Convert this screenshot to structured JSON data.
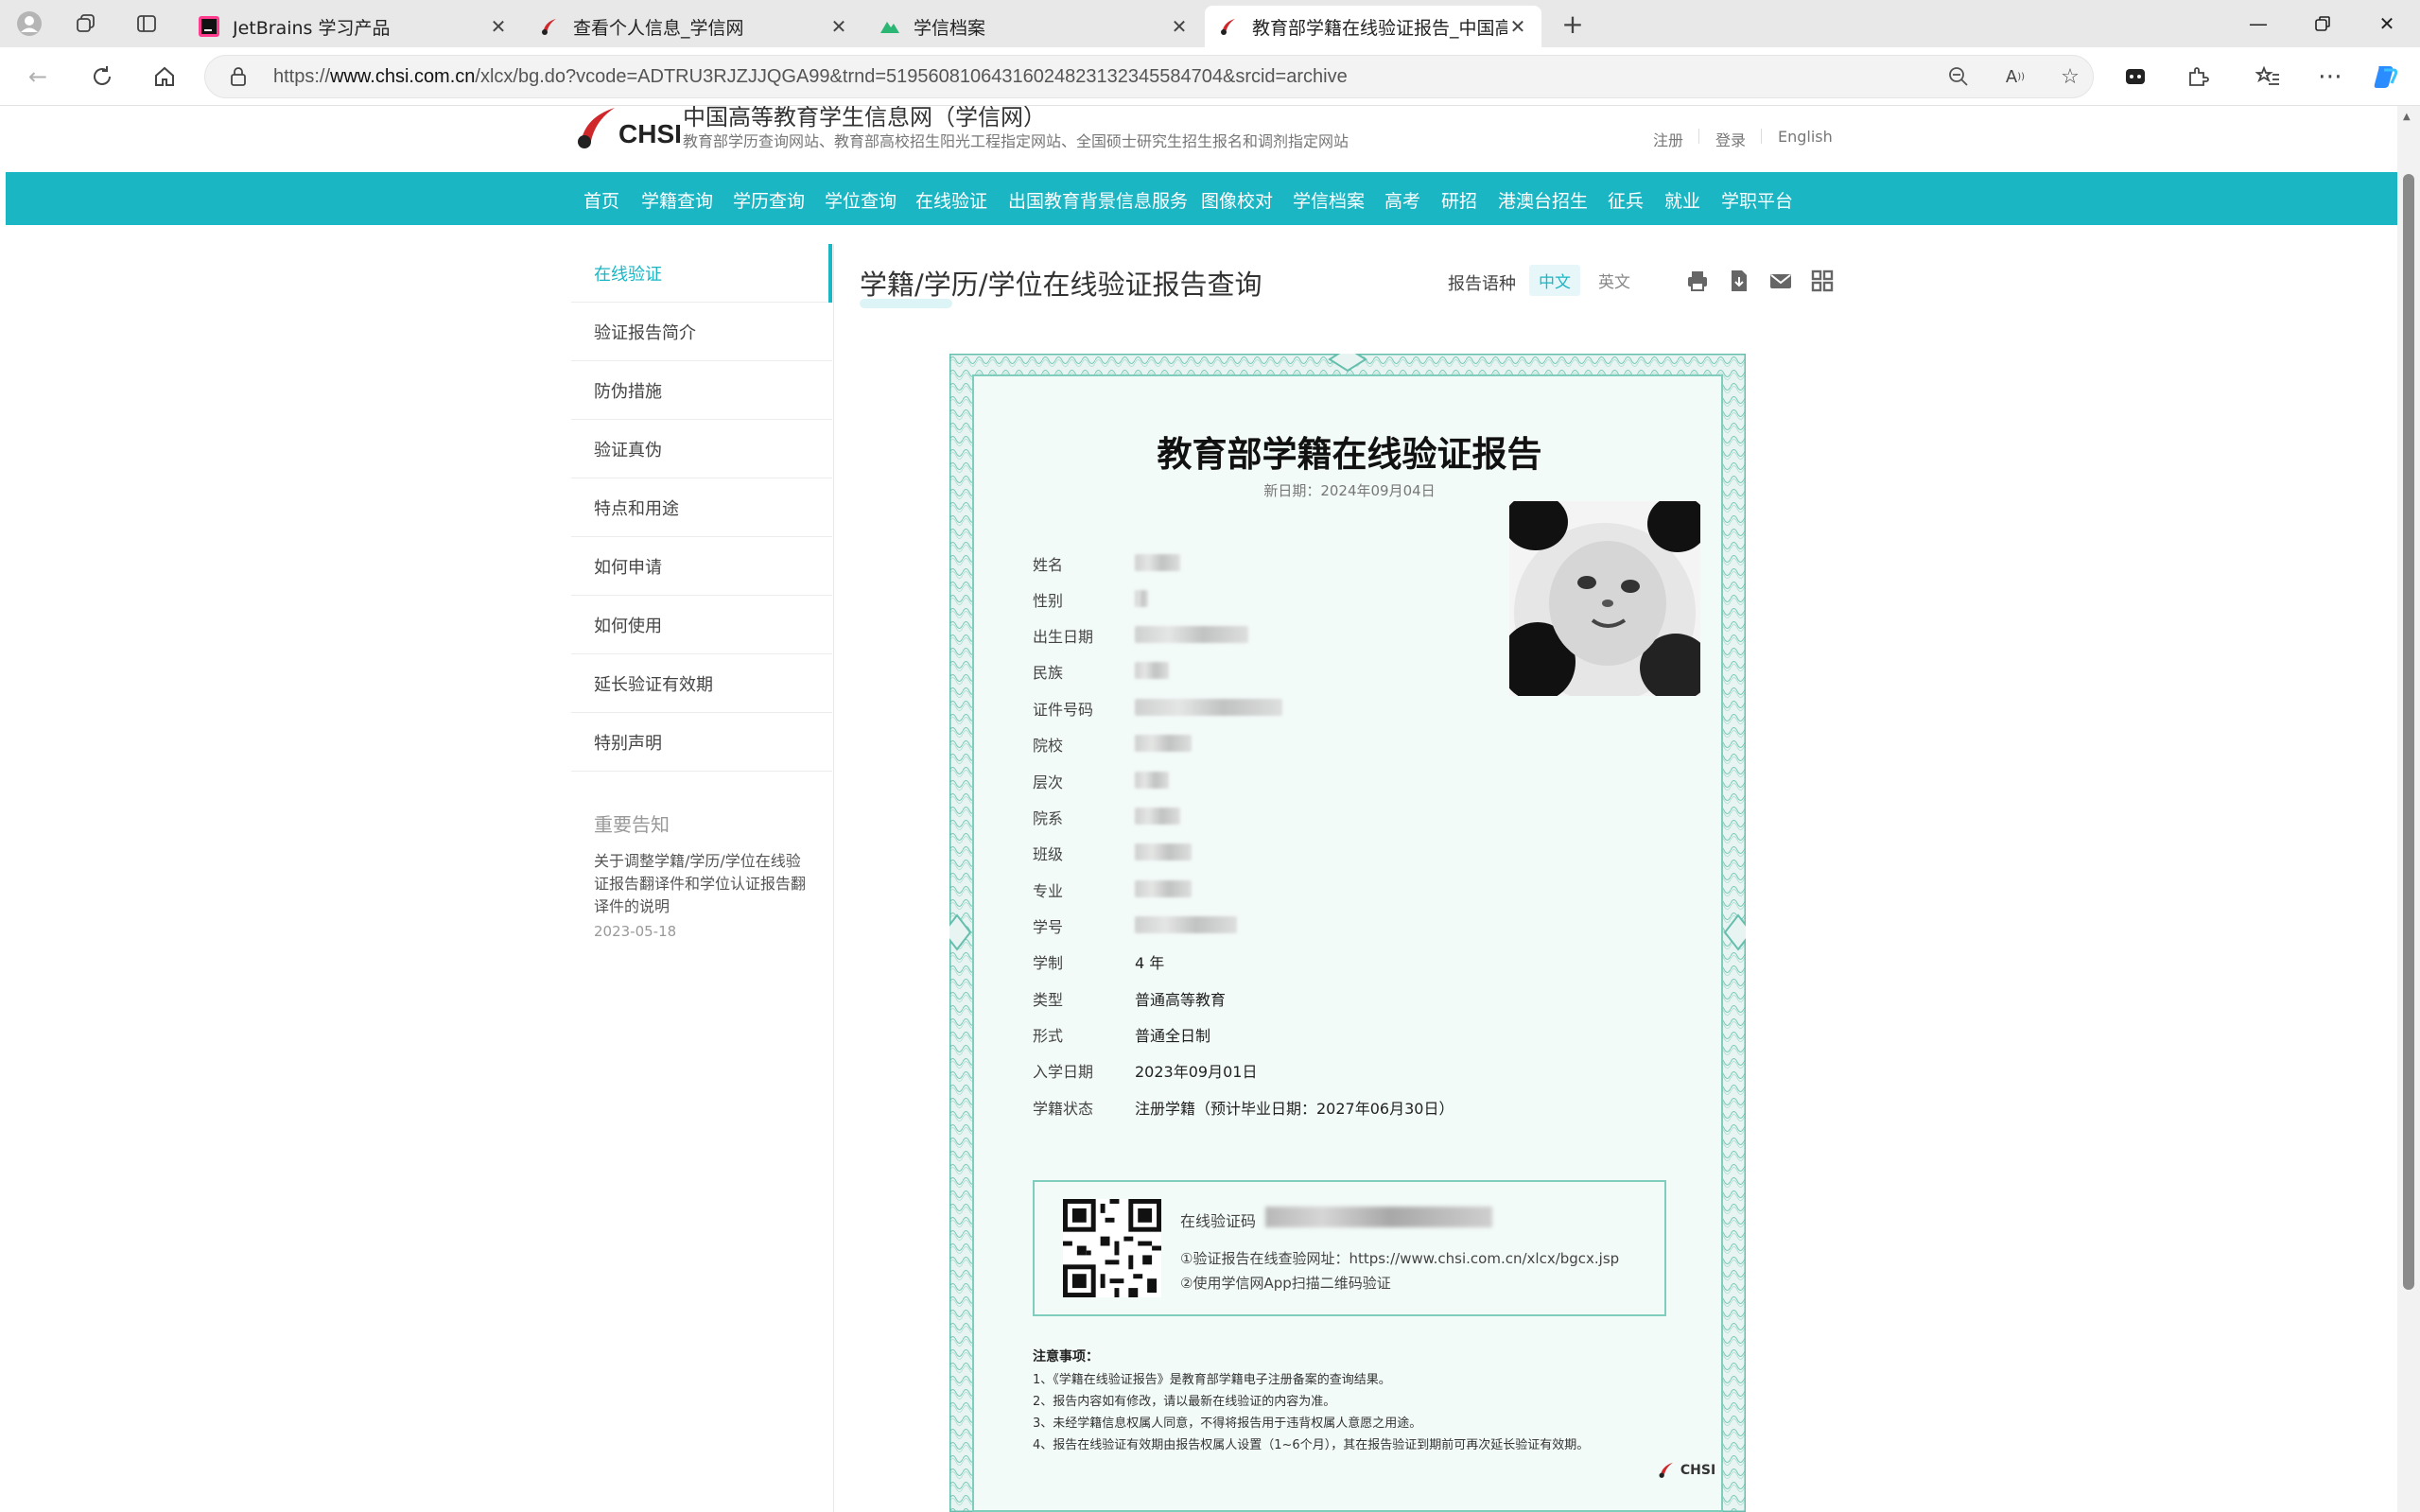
{
  "browser": {
    "tabs": [
      {
        "title": "JetBrains 学习产品",
        "active": false
      },
      {
        "title": "查看个人信息_学信网",
        "active": false
      },
      {
        "title": "学信档案",
        "active": false
      },
      {
        "title": "教育部学籍在线验证报告_中国高等",
        "active": true
      }
    ],
    "new_tab": "+",
    "url_prefix": "https://",
    "url_host": "www.chsi.com.cn",
    "url_path": "/xlcx/bg.do?vcode=ADTRU3RJZJJQGA99&trnd=51956081064316024823132345584704&srcid=archive"
  },
  "site": {
    "logo_text": "CHSI",
    "title": "中国高等教育学生信息网（学信网）",
    "subtitle": "教育部学历查询网站、教育部高校招生阳光工程指定网站、全国硕士研究生招生报名和调剂指定网站",
    "top_links": [
      "注册",
      "登录",
      "English"
    ],
    "nav": [
      "首页",
      "学籍查询",
      "学历查询",
      "学位查询",
      "在线验证",
      "出国教育背景信息服务",
      "图像校对",
      "学信档案",
      "高考",
      "研招",
      "港澳台招生",
      "征兵",
      "就业",
      "学职平台"
    ]
  },
  "sidebar": {
    "items": [
      "在线验证",
      "验证报告简介",
      "防伪措施",
      "验证真伪",
      "特点和用途",
      "如何申请",
      "如何使用",
      "延长验证有效期",
      "特别声明"
    ],
    "active_index": 0,
    "notice_title": "重要告知",
    "notice_link": "关于调整学籍/学历/学位在线验证报告翻译件和学位认证报告翻译件的说明",
    "notice_date": "2023-05-18"
  },
  "content": {
    "title": "学籍/学历/学位在线验证报告查询",
    "lang_label": "报告语种",
    "lang_zh": "中文",
    "lang_en": "英文"
  },
  "report": {
    "title": "教育部学籍在线验证报告",
    "update_date": "新日期：2024年09月04日",
    "fields": [
      {
        "label": "姓名"
      },
      {
        "label": "性别"
      },
      {
        "label": "出生日期"
      },
      {
        "label": "民族"
      },
      {
        "label": "证件号码"
      },
      {
        "label": "院校"
      },
      {
        "label": "层次"
      },
      {
        "label": "院系"
      },
      {
        "label": "班级"
      },
      {
        "label": "专业"
      },
      {
        "label": "学号"
      },
      {
        "label": "学制",
        "value": "4 年"
      },
      {
        "label": "类型",
        "value": "普通高等教育"
      },
      {
        "label": "形式",
        "value": "普通全日制"
      },
      {
        "label": "入学日期",
        "value": "2023年09月01日"
      },
      {
        "label": "学籍状态",
        "value": "注册学籍（预计毕业日期：2027年06月30日）"
      }
    ],
    "verify_code_label": "在线验证码",
    "verify_line1": "①验证报告在线查验网址：https://www.chsi.com.cn/xlcx/bgcx.jsp",
    "verify_line2": "②使用学信网App扫描二维码验证",
    "notes_title": "注意事项：",
    "notes": [
      "1、《学籍在线验证报告》是教育部学籍电子注册备案的查询结果。",
      "2、报告内容如有修改，请以最新在线验证的内容为准。",
      "3、未经学籍信息权属人同意，不得将报告用于违背权属人意愿之用途。",
      "4、报告在线验证有效期由报告权属人设置（1~6个月），其在报告验证到期前可再次延长验证有效期。"
    ],
    "logo": "CHSI"
  },
  "colors": {
    "accent": "#1bb6c4",
    "cert_border": "#7fcdbd"
  }
}
